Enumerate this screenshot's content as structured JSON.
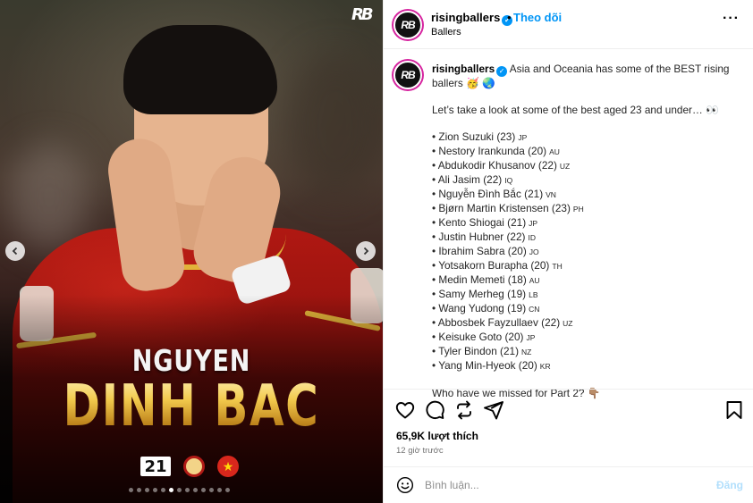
{
  "media": {
    "logo": "RB",
    "player_first_name": "NGUYEN",
    "player_last_name": "DINH BAC",
    "age": "21",
    "club_icon": "club-crest-icon",
    "flag_icon": "vietnam-flag-icon",
    "slide_count": 13,
    "active_slide": 5,
    "prev_icon": "chevron-left-icon",
    "next_icon": "chevron-right-icon",
    "colors": {
      "gold": "#d9a73a",
      "shirt": "#b01812"
    }
  },
  "post": {
    "username": "risingballers",
    "verified": true,
    "separator": "•",
    "follow_label": "Theo dõi",
    "subtitle": "Ballers",
    "more_icon": "more-options-icon",
    "avatar_text": "RB",
    "caption": {
      "intro": "Asia and Oceania has some of the BEST rising",
      "intro2": "ballers 🥳 🌏",
      "lead": "Let’s take a look at some of the best aged 23 and under… 👀",
      "players": [
        {
          "text": "• Zion Suzuki (23)",
          "cc": "JP"
        },
        {
          "text": "• Nestory Irankunda (20)",
          "cc": "AU"
        },
        {
          "text": "• Abdukodir Khusanov (22)",
          "cc": "UZ"
        },
        {
          "text": "• Ali Jasim (22)",
          "cc": "IQ"
        },
        {
          "text": "• Nguyễn Đình Bắc (21)",
          "cc": "VN"
        },
        {
          "text": "• Bjørn Martin Kristensen (23)",
          "cc": "PH"
        },
        {
          "text": "• Kento Shiogai (21)",
          "cc": "JP"
        },
        {
          "text": "• Justin Hubner (22)",
          "cc": "ID"
        },
        {
          "text": "• Ibrahim Sabra (20)",
          "cc": "JO"
        },
        {
          "text": "• Yotsakorn Burapha (20)",
          "cc": "TH"
        },
        {
          "text": "• Medin Memeti (18)",
          "cc": "AU"
        },
        {
          "text": "• Samy Merheg (19)",
          "cc": "LB"
        },
        {
          "text": "• Wang Yudong (19)",
          "cc": "CN"
        },
        {
          "text": "• Abbosbek Fayzullaev (22)",
          "cc": "UZ"
        },
        {
          "text": "• Keisuke Goto (20)",
          "cc": "JP"
        },
        {
          "text": "• Tyler Bindon (21)",
          "cc": "NZ"
        },
        {
          "text": "• Yang Min-Hyeok (20)",
          "cc": "KR"
        }
      ],
      "outro": "Who have we missed for Part 2? 👇🏽"
    },
    "actions": {
      "like_icon": "heart-icon",
      "comment_icon": "comment-icon",
      "repost_icon": "repost-icon",
      "share_icon": "share-icon",
      "save_icon": "bookmark-icon"
    },
    "likes": "65,9K lượt thích",
    "time": "12 giờ trước",
    "comment": {
      "emoji_icon": "emoji-icon",
      "placeholder": "Bình luận...",
      "value": "",
      "post_label": "Đăng"
    }
  }
}
